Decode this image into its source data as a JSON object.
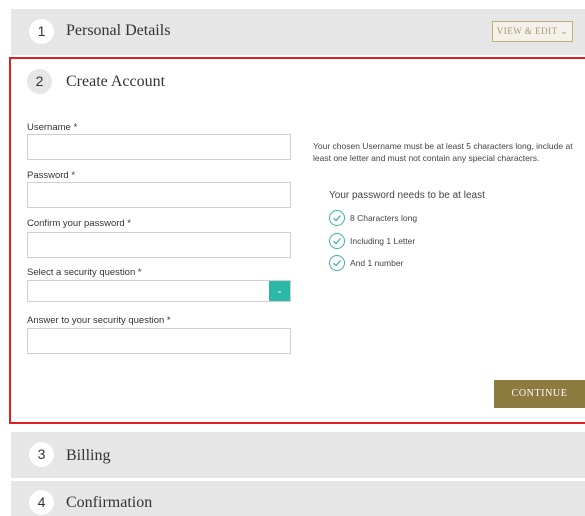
{
  "steps": {
    "step1": {
      "number": "1",
      "title": "Personal Details",
      "view_edit_label": "VIEW & EDIT ⌄"
    },
    "step2": {
      "number": "2",
      "title": "Create Account"
    },
    "step3": {
      "number": "3",
      "title": "Billing"
    },
    "step4": {
      "number": "4",
      "title": "Confirmation"
    }
  },
  "form": {
    "username_label": "Username *",
    "username_value": "",
    "password_label": "Password *",
    "password_value": "",
    "confirm_label": "Confirm your password *",
    "confirm_value": "",
    "security_question_label": "Select a security question *",
    "security_question_value": "",
    "answer_label": "Answer to your security question *",
    "answer_value": ""
  },
  "username_hint": "Your chosen Username must be at least 5 characters long, include at least one letter and must not contain any special characters.",
  "password_requirements": {
    "heading": "Your password needs to be at least",
    "items": [
      "8 Characters long",
      "Including 1 Letter",
      "And 1 number"
    ]
  },
  "continue_label": "CONTINUE",
  "icons": {
    "check": "check-circle-icon",
    "dropdown": "chevron-down-icon",
    "accent_color": "#2bb8a7",
    "continue_color": "#8c7a3e",
    "highlight_border": "#e02020"
  }
}
